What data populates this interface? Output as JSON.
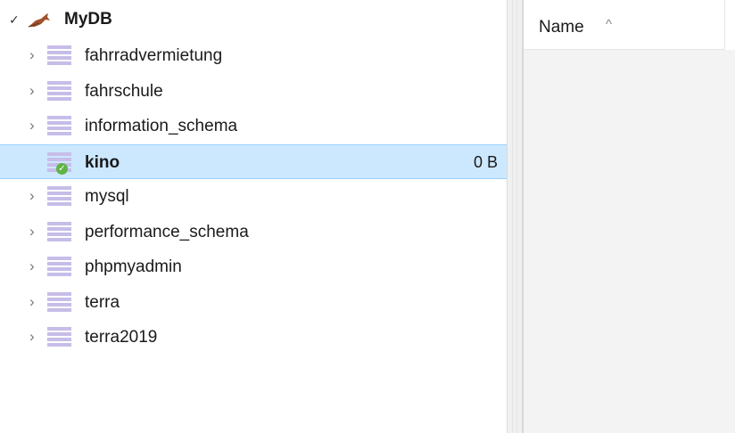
{
  "tree": {
    "root": {
      "label": "MyDB",
      "check_glyph": "✓",
      "icon": "mysql-dolphin-icon"
    },
    "expander_glyph": "›",
    "items": [
      {
        "label": "fahrradvermietung",
        "size": "",
        "selected": false
      },
      {
        "label": "fahrschule",
        "size": "",
        "selected": false
      },
      {
        "label": "information_schema",
        "size": "",
        "selected": false
      },
      {
        "label": "kino",
        "size": "0 B",
        "selected": true
      },
      {
        "label": "mysql",
        "size": "",
        "selected": false
      },
      {
        "label": "performance_schema",
        "size": "",
        "selected": false
      },
      {
        "label": "phpmyadmin",
        "size": "",
        "selected": false
      },
      {
        "label": "terra",
        "size": "",
        "selected": false
      },
      {
        "label": "terra2019",
        "size": "",
        "selected": false
      }
    ]
  },
  "list": {
    "columns": [
      {
        "label": "Name",
        "sort_glyph": "^"
      }
    ]
  },
  "colors": {
    "selection_bg": "#cce8ff",
    "selection_border": "#99d1ff",
    "db_icon": "#c7bde8",
    "check_badge": "#5fb446",
    "dolphin": "#a0522d"
  }
}
